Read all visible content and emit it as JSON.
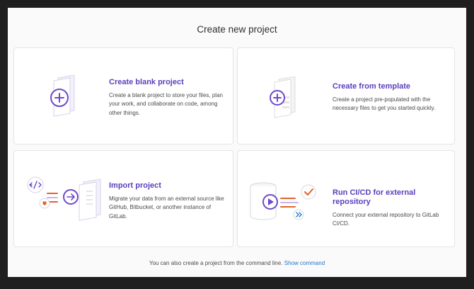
{
  "page": {
    "title": "Create new project"
  },
  "cards": [
    {
      "title": "Create blank project",
      "description": "Create a blank project to store your files, plan your work, and collaborate on code, among other things.",
      "illustration": "blank-project-icon"
    },
    {
      "title": "Create from template",
      "description": "Create a project pre-populated with the necessary files to get you started quickly.",
      "illustration": "template-project-icon"
    },
    {
      "title": "Import project",
      "description": "Migrate your data from an external source like GitHub, Bitbucket, or another instance of GitLab.",
      "illustration": "import-project-icon"
    },
    {
      "title": "Run CI/CD for external repository",
      "description": "Connect your external repository to GitLab CI/CD.",
      "illustration": "cicd-project-icon"
    }
  ],
  "footer": {
    "text": "You can also create a project from the command line.",
    "link": "Show command"
  },
  "colors": {
    "accent": "#5a3fbc",
    "link": "#1f75cb",
    "orange": "#e2632c",
    "green": "#3aa66f"
  }
}
